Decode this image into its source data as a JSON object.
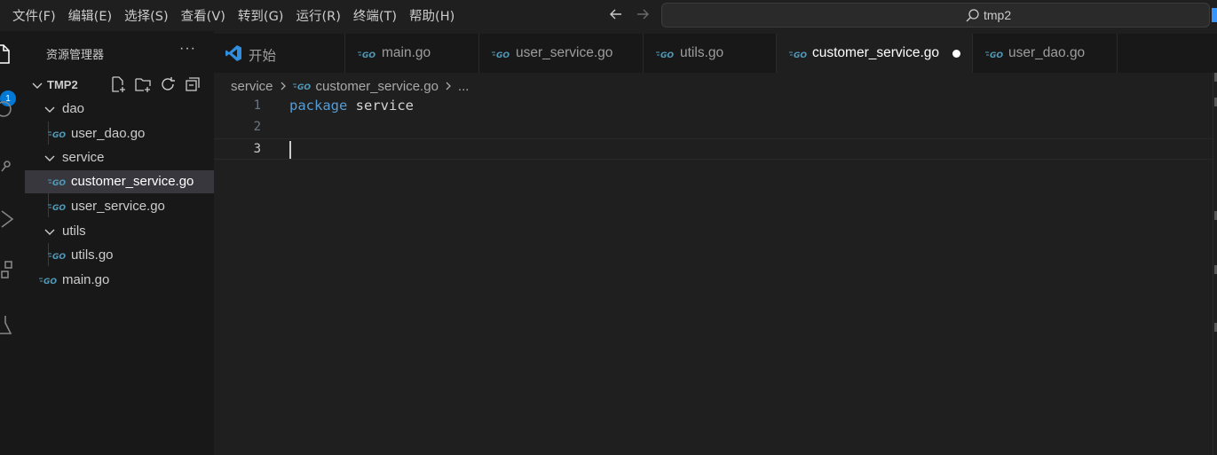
{
  "menu": [
    "文件(F)",
    "编辑(E)",
    "选择(S)",
    "查看(V)",
    "转到(G)",
    "运行(R)",
    "终端(T)",
    "帮助(H)"
  ],
  "search": {
    "text": "tmp2"
  },
  "activity": {
    "badge": "1"
  },
  "sidebar": {
    "title": "资源管理器",
    "more": "···",
    "root": "TMP2",
    "tree": [
      {
        "type": "folder",
        "name": "dao"
      },
      {
        "type": "file",
        "name": "user_dao.go"
      },
      {
        "type": "folder",
        "name": "service"
      },
      {
        "type": "file",
        "name": "customer_service.go",
        "selected": true
      },
      {
        "type": "file",
        "name": "user_service.go"
      },
      {
        "type": "folder",
        "name": "utils"
      },
      {
        "type": "file",
        "name": "utils.go"
      },
      {
        "type": "file",
        "name": "main.go"
      }
    ]
  },
  "tabs": [
    {
      "label": "开始"
    },
    {
      "label": "main.go"
    },
    {
      "label": "user_service.go"
    },
    {
      "label": "utils.go"
    },
    {
      "label": "customer_service.go",
      "active": true,
      "dirty": true
    },
    {
      "label": "user_dao.go"
    }
  ],
  "breadcrumb": {
    "folder": "service",
    "file": "customer_service.go",
    "tail": "..."
  },
  "editor": {
    "lines": [
      {
        "number": "1",
        "keyword": "package",
        "ident": "service"
      },
      {
        "number": "2",
        "keyword": "",
        "ident": ""
      },
      {
        "number": "3",
        "keyword": "",
        "ident": ""
      }
    ],
    "current_line": 3
  },
  "colors": {
    "keyword": "#569cd6",
    "accent": "#0078d4",
    "go_icon": "#519aba"
  }
}
